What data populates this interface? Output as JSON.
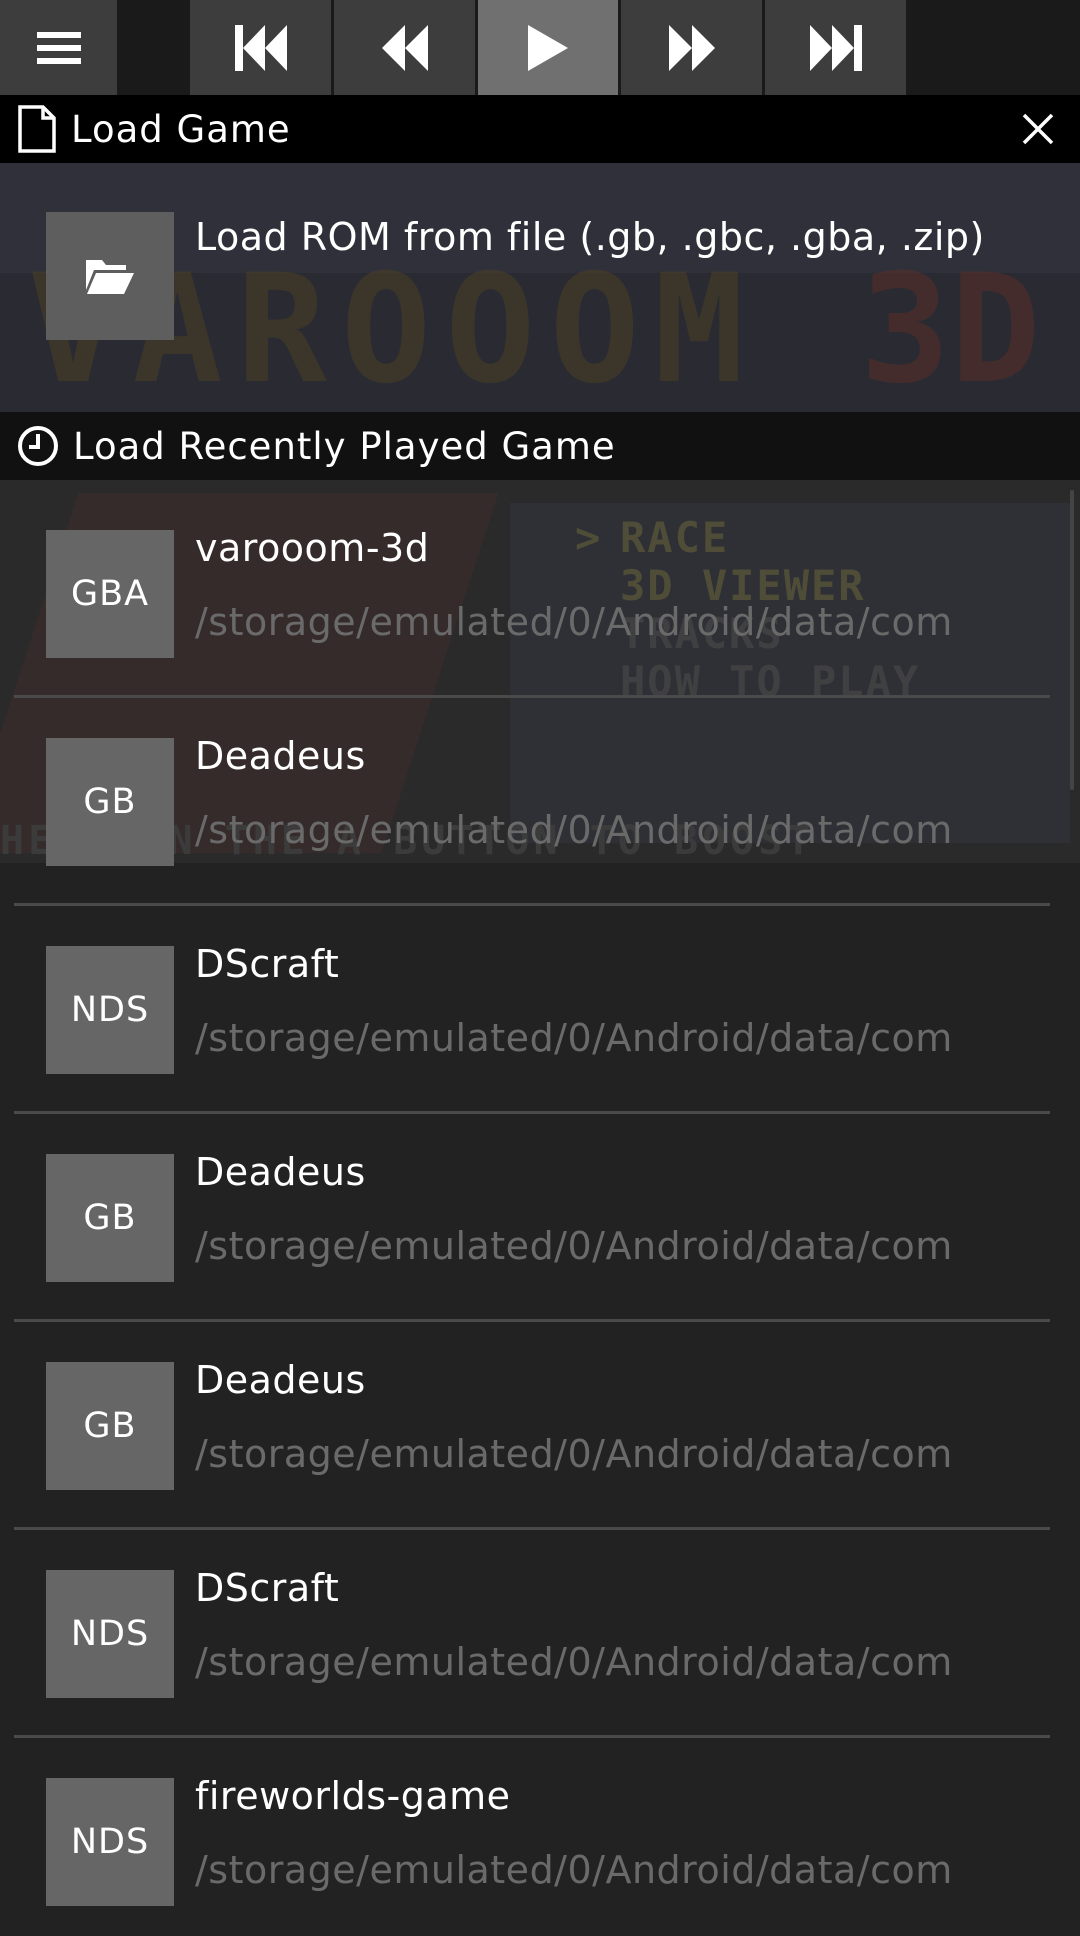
{
  "toolbar": {
    "buttons": [
      {
        "name": "menu-icon"
      },
      {
        "name": "skip-previous-icon"
      },
      {
        "name": "rewind-icon"
      },
      {
        "name": "play-icon",
        "active": true
      },
      {
        "name": "fast-forward-icon"
      },
      {
        "name": "skip-next-icon"
      }
    ]
  },
  "load_game": {
    "title": "Load Game",
    "rom_label": "Load ROM from file (.gb, .gbc, .gba, .zip)"
  },
  "background": {
    "logo": "VAROOOM",
    "logo_3d": "3D",
    "menu": [
      "RACE",
      "3D VIEWER",
      "TRACKS",
      "HOW TO PLAY"
    ],
    "footer": "HELD ON THE A BUTTON TO BOOST"
  },
  "recent": {
    "title": "Load Recently Played Game",
    "items": [
      {
        "badge": "GBA",
        "name": "varooom-3d",
        "path": "/storage/emulated/0/Android/data/com"
      },
      {
        "badge": "GB",
        "name": "Deadeus",
        "path": "/storage/emulated/0/Android/data/com"
      },
      {
        "badge": "NDS",
        "name": "DScraft",
        "path": "/storage/emulated/0/Android/data/com"
      },
      {
        "badge": "GB",
        "name": "Deadeus",
        "path": "/storage/emulated/0/Android/data/com"
      },
      {
        "badge": "GB",
        "name": "Deadeus",
        "path": "/storage/emulated/0/Android/data/com"
      },
      {
        "badge": "NDS",
        "name": "DScraft",
        "path": "/storage/emulated/0/Android/data/com"
      },
      {
        "badge": "NDS",
        "name": "fireworlds-game",
        "path": "/storage/emulated/0/Android/data/com"
      }
    ]
  },
  "colors": {
    "background": "#222222",
    "header": "#000000",
    "badge": "#666666",
    "path_text": "#6a6a6a",
    "active_button": "#707070"
  }
}
